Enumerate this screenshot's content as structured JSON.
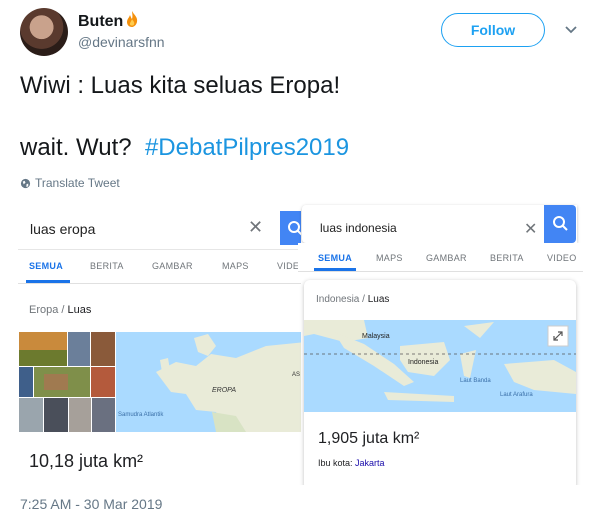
{
  "user": {
    "name": "Buten",
    "handle": "@devinarsfnn"
  },
  "follow_label": "Follow",
  "tweet": {
    "line1": "Wiwi : Luas kita seluas Eropa!",
    "line2_text": "wait. Wut?",
    "hashtag": "#DebatPilpres2019"
  },
  "translate_label": "Translate Tweet",
  "left_shot": {
    "query": "luas eropa",
    "tabs": [
      "SEMUA",
      "BERITA",
      "GAMBAR",
      "MAPS",
      "VIDE"
    ],
    "crumb_root": "Eropa",
    "crumb_leaf": "Luas",
    "map_labels": {
      "region": "EROPA",
      "ocean": "Samudra Atlantik",
      "edge": "AS"
    },
    "value": "10,18 juta km²"
  },
  "right_shot": {
    "query": "luas indonesia",
    "tabs": [
      "SEMUA",
      "MAPS",
      "GAMBAR",
      "BERITA",
      "VIDEO"
    ],
    "crumb_root": "Indonesia",
    "crumb_leaf": "Luas",
    "map_labels": {
      "malaysia": "Malaysia",
      "indonesia": "Indonesia",
      "banda": "Laut Banda",
      "arafura": "Laut Arafura"
    },
    "value": "1,905 juta km²",
    "capital_label": "Ibu kota:",
    "capital": "Jakarta"
  },
  "timestamp": "7:25 AM - 30 Mar 2019",
  "colors": {
    "twitter_blue": "#1da1f2",
    "google_blue": "#4285f4",
    "hashtag": "#1b95e0",
    "map_water": "#aadaff",
    "map_land": "#e9ebd8"
  },
  "icons": [
    "fire-emoji-icon",
    "chevron-down-icon",
    "globe-icon",
    "close-icon",
    "search-icon",
    "expand-icon"
  ]
}
